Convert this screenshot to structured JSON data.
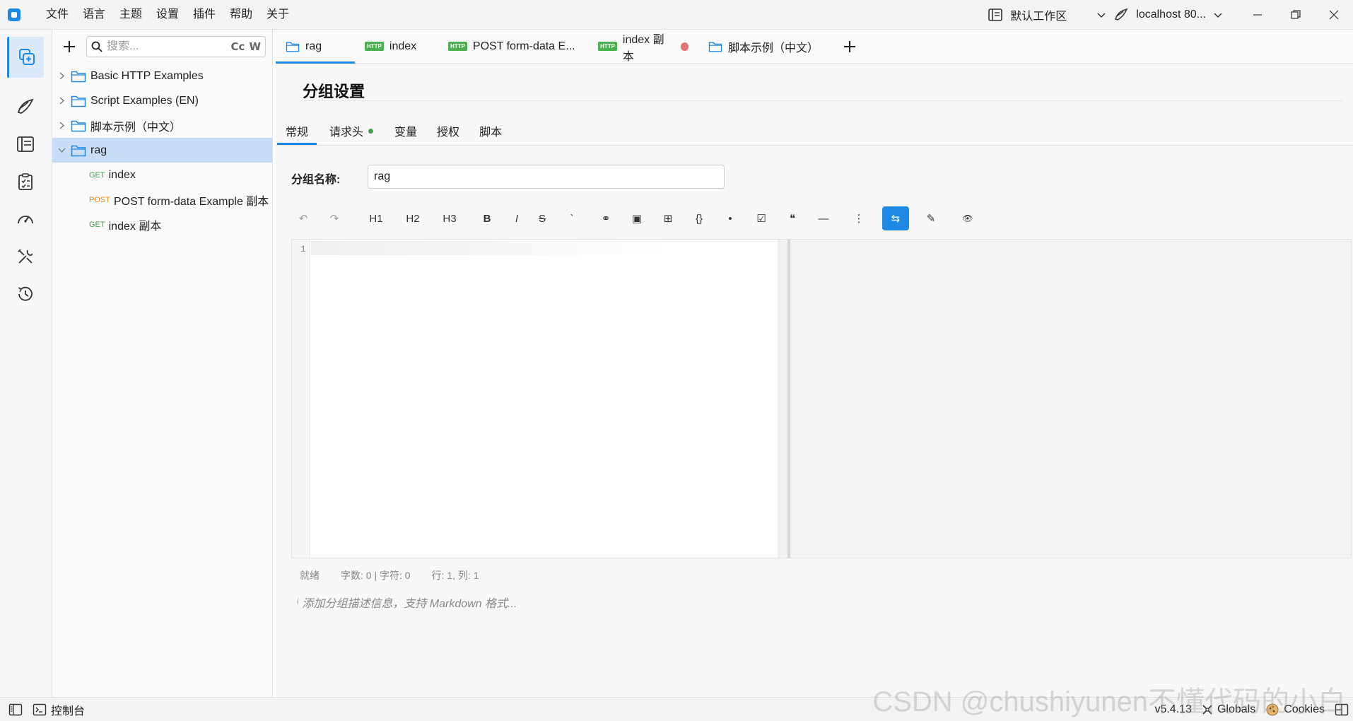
{
  "menu": [
    "文件",
    "语言",
    "主题",
    "设置",
    "插件",
    "帮助",
    "关于"
  ],
  "workspace": "默认工作区",
  "environment": "localhost 80...",
  "search_placeholder": "搜索...",
  "search_opts": {
    "case": "Cc",
    "word": "W"
  },
  "tree": [
    {
      "label": "Basic HTTP Examples"
    },
    {
      "label": "Script Examples (EN)"
    },
    {
      "label": "脚本示例（中文）"
    },
    {
      "label": "rag"
    }
  ],
  "requests": [
    {
      "method": "GET",
      "label": "index"
    },
    {
      "method": "POST",
      "label": "POST form-data Example 副本"
    },
    {
      "method": "GET",
      "label": "index 副本"
    }
  ],
  "tabs": [
    {
      "label": "rag"
    },
    {
      "badge": "HTTP",
      "label": "index"
    },
    {
      "badge": "HTTP",
      "label": "POST form-data E..."
    },
    {
      "badge": "HTTP",
      "label": "index 副本"
    },
    {
      "label": "脚本示例（中文）"
    }
  ],
  "page_title": "分组设置",
  "subtabs": [
    "常规",
    "请求头",
    "变量",
    "授权",
    "脚本"
  ],
  "field_label": "分组名称:",
  "field_value": "rag",
  "toolbar": [
    "↶",
    "↷",
    "H1",
    "H2",
    "H3",
    "B",
    "I",
    "S",
    "`",
    "⚭",
    "▣",
    "⊞",
    "{}",
    "•",
    "☑",
    "❝",
    "—",
    "⋮",
    "⇆",
    "✎",
    "👁"
  ],
  "editor_line": "1",
  "status": {
    "ready": "就绪",
    "counts": "字数: 0 | 字符: 0",
    "position": "行: 1, 列: 1"
  },
  "hint": "添加分组描述信息，支持 Markdown 格式...",
  "statusbar": {
    "console": "控制台",
    "version": "v5.4.13",
    "globals": "Globals",
    "cookies": "Cookies"
  },
  "watermark": "CSDN @chushiyunen不懂代码的小白",
  "colors": {
    "accent": "#1e88e5",
    "get": "#3fa34d",
    "post": "#f08c2b",
    "http_badge": "#4caf50",
    "dirty": "#e57373"
  }
}
